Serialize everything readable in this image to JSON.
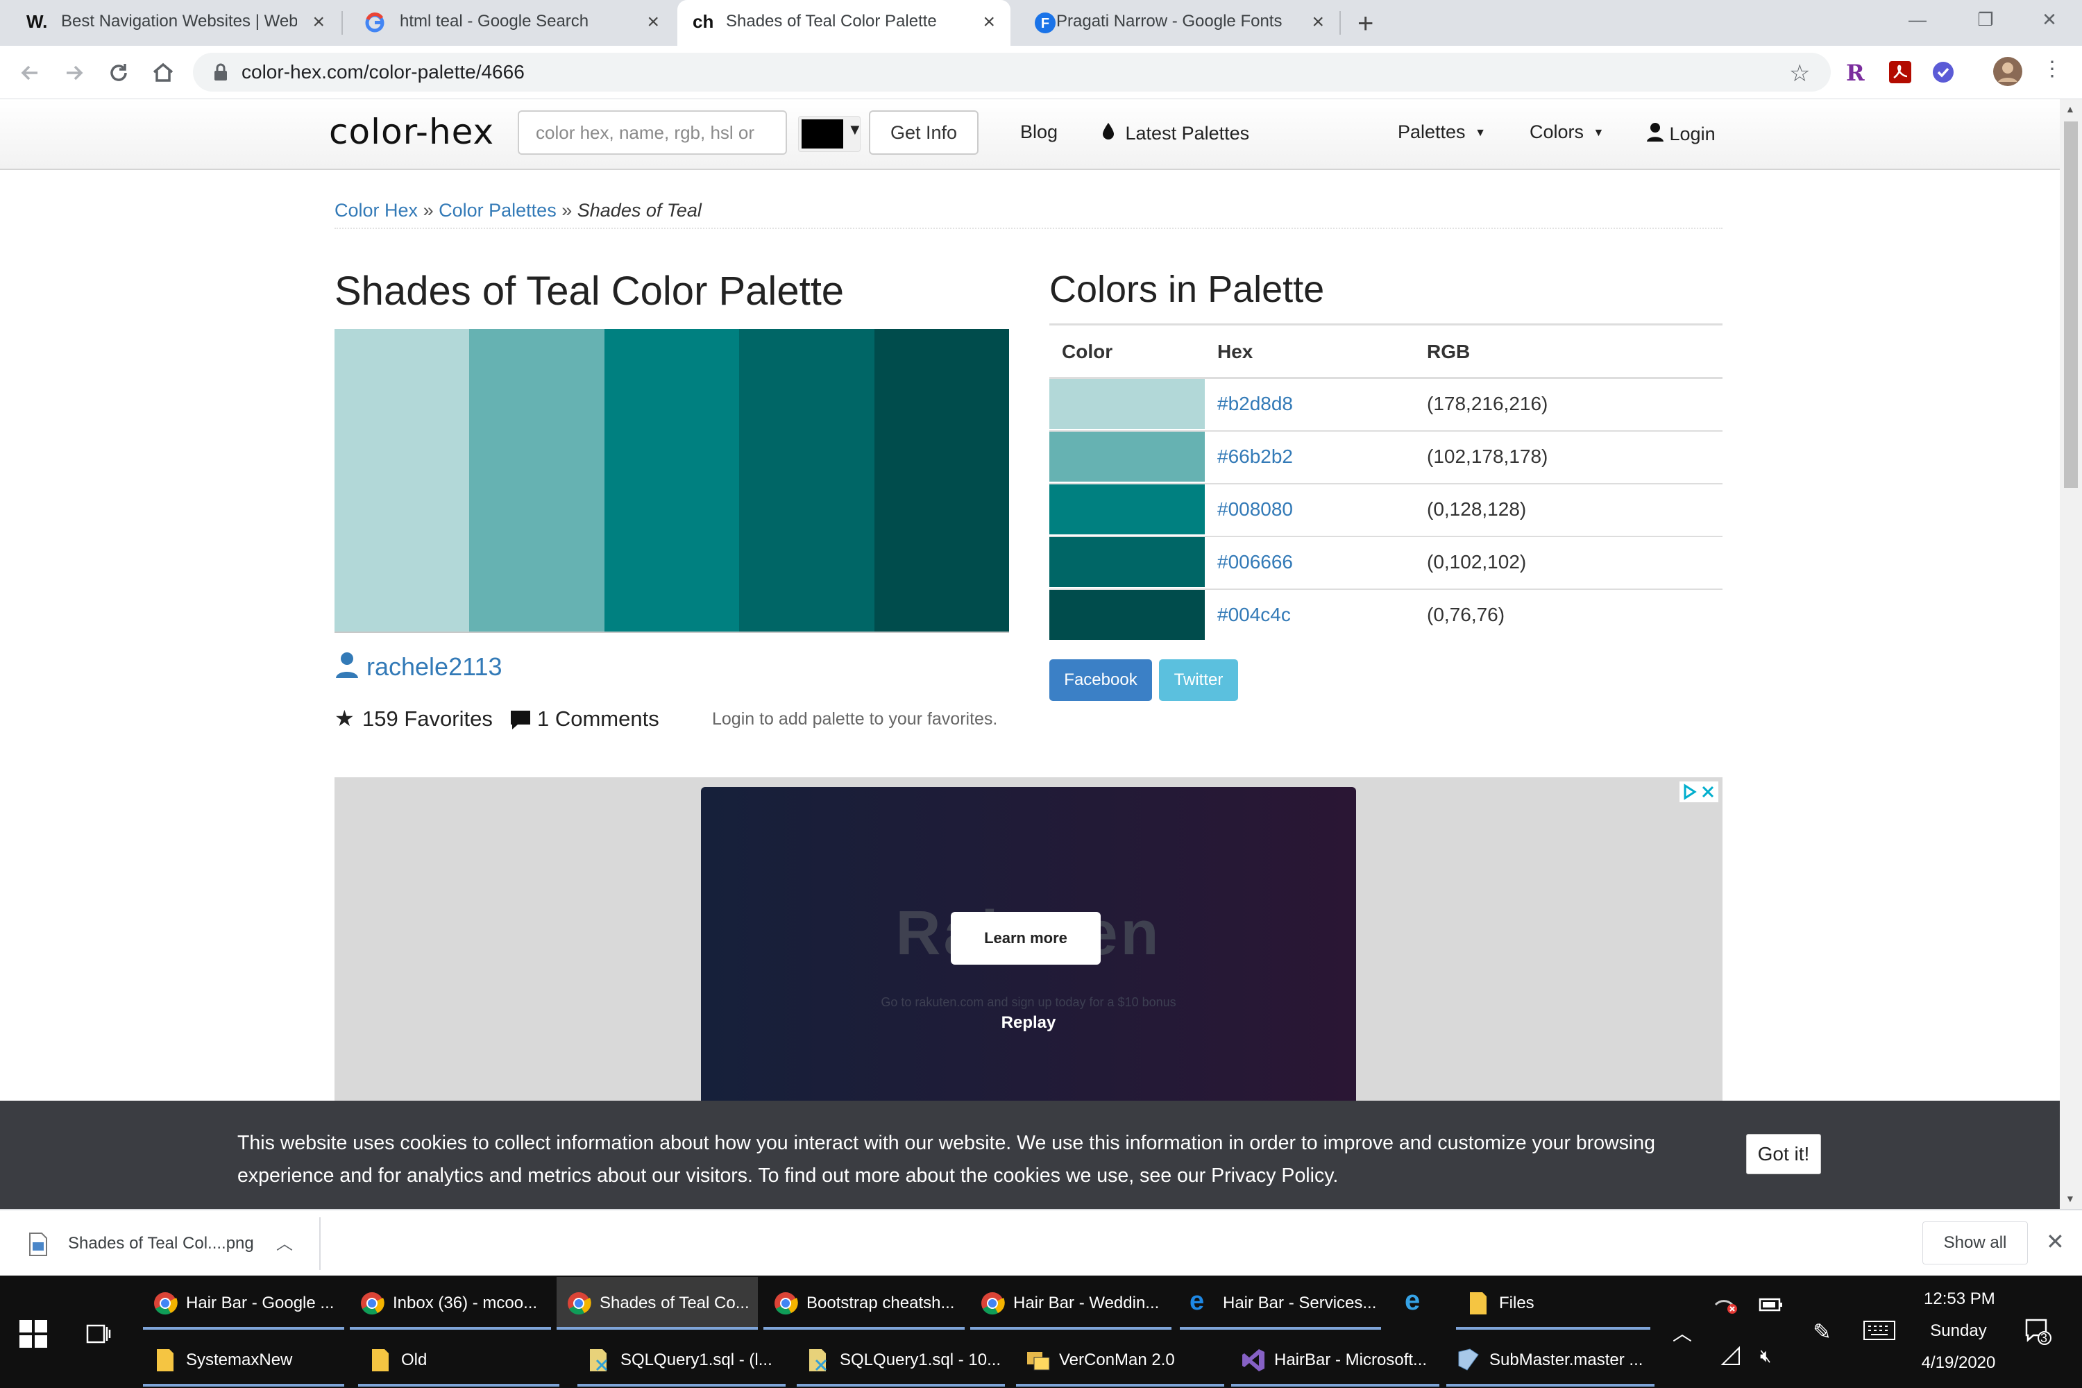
{
  "browser": {
    "tabs": [
      {
        "title": "Best Navigation Websites | Web D",
        "favicon": "W."
      },
      {
        "title": "html teal - Google Search",
        "favicon": "google-g"
      },
      {
        "title": "Shades of Teal Color Palette",
        "favicon": "ch"
      },
      {
        "title": "Pragati Narrow - Google Fonts",
        "favicon": "F"
      }
    ],
    "url": "color-hex.com/color-palette/4666"
  },
  "site": {
    "logo": "color-hex",
    "search_placeholder": "color hex, name, rgb, hsl or",
    "get_info": "Get Info",
    "nav": {
      "blog": "Blog",
      "latest": "Latest Palettes",
      "palettes": "Palettes",
      "colors": "Colors",
      "login": "Login"
    }
  },
  "breadcrumb": {
    "home": "Color Hex",
    "sep": "»",
    "palettes": "Color Palettes",
    "current": "Shades of Teal"
  },
  "palette": {
    "title": "Shades of Teal Color Palette",
    "author": "rachele2113",
    "favorites": "159 Favorites",
    "comments": "1 Comments",
    "login_note": "Login to add palette to your favorites.",
    "colors_title": "Colors in Palette",
    "table_headers": {
      "color": "Color",
      "hex": "Hex",
      "rgb": "RGB"
    },
    "colors": [
      {
        "hex": "#b2d8d8",
        "rgb": "(178,216,216)"
      },
      {
        "hex": "#66b2b2",
        "rgb": "(102,178,178)"
      },
      {
        "hex": "#008080",
        "rgb": "(0,128,128)"
      },
      {
        "hex": "#006666",
        "rgb": "(0,102,102)"
      },
      {
        "hex": "#004c4c",
        "rgb": "(0,76,76)"
      }
    ],
    "share": {
      "facebook": "Facebook",
      "twitter": "Twitter"
    }
  },
  "ad": {
    "brand": "Rakuten",
    "learn_more": "Learn more",
    "text": "Go to rakuten.com and sign up today for a $10 bonus",
    "replay": "Replay"
  },
  "cookie": {
    "text_before": "This website uses cookies to collect information about how you interact with our website. We use this information in order to improve and customize your browsing experience and for analytics and metrics about our visitors. To find out more about the cookies we use, see our ",
    "policy": "Privacy Policy",
    "text_after": ".",
    "button": "Got it!"
  },
  "download": {
    "file": "Shades of Teal Col....png",
    "show_all": "Show all"
  },
  "taskbar": {
    "row1": [
      "Hair Bar - Google ...",
      "Inbox (36) - mcoo...",
      "Shades of Teal Co...",
      "Bootstrap cheatsh...",
      "Hair Bar - Weddin...",
      "Hair Bar - Services...",
      "",
      "Files"
    ],
    "row2": [
      "SystemaxNew",
      "Old",
      "SQLQuery1.sql - (l...",
      "SQLQuery1.sql - 10...",
      "VerConMan 2.0",
      "HairBar - Microsoft...",
      "SubMaster.master ..."
    ],
    "time": "12:53 PM",
    "day": "Sunday",
    "date": "4/19/2020",
    "notifications": "3"
  },
  "colors": {
    "link": "#337ab7",
    "facebook": "#3b80c6",
    "twitter": "#5bc0de",
    "cookie_bg": "#3b3d42"
  }
}
